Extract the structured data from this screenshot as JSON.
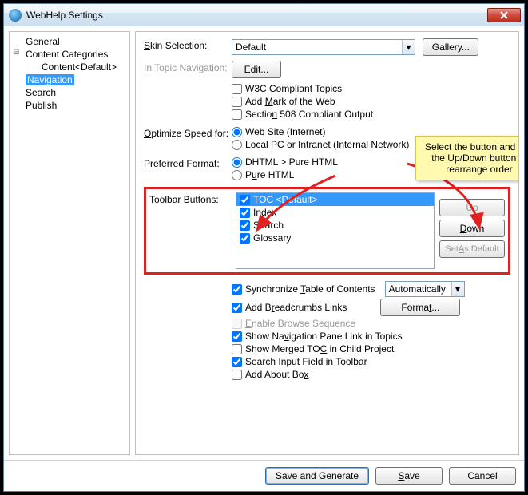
{
  "window": {
    "title": "WebHelp Settings"
  },
  "tree": {
    "items": [
      {
        "label": "General"
      },
      {
        "label": "Content Categories"
      },
      {
        "label": "Content<Default>"
      },
      {
        "label": "Navigation",
        "selected": true
      },
      {
        "label": "Search"
      },
      {
        "label": "Publish"
      }
    ]
  },
  "settings": {
    "skin_label": "Skin Selection:",
    "skin_value": "Default",
    "gallery_btn": "Gallery...",
    "in_topic_nav_label": "In Topic Navigation:",
    "edit_btn": "Edit...",
    "opts1": [
      "W3C Compliant Topics",
      "Add Mark of the Web",
      "Section 508 Compliant Output"
    ],
    "optimize_label": "Optimize Speed for:",
    "optimize_opts": [
      "Web Site (Internet)",
      "Local PC or Intranet (Internal Network)"
    ],
    "preferred_label": "Preferred Format:",
    "preferred_opts": [
      "DHTML > Pure HTML",
      "Pure HTML"
    ],
    "toolbar_label": "Toolbar Buttons:",
    "toolbar_items": [
      {
        "label": "TOC <Default>",
        "selected": true
      },
      {
        "label": "Index"
      },
      {
        "label": "Search"
      },
      {
        "label": "Glossary"
      }
    ],
    "up_btn": "Up",
    "down_btn": "Down",
    "set_default_btn": "Set As Default",
    "sync_toc": "Synchronize Table of Contents",
    "sync_mode": "Automatically",
    "add_breadcrumbs": "Add Breadcrumbs Links",
    "format_btn": "Format...",
    "enable_browse": "Enable Browse Sequence",
    "show_nav_link": "Show Navigation Pane Link in Topics",
    "show_merged_toc": "Show Merged TOC in Child Project",
    "search_input_toolbar": "Search Input Field in Toolbar",
    "add_about_box": "Add About Box"
  },
  "callout": "Select the button and use the Up/Down button to rearrange order",
  "footer": {
    "save_generate": "Save and Generate",
    "save": "Save",
    "cancel": "Cancel"
  }
}
